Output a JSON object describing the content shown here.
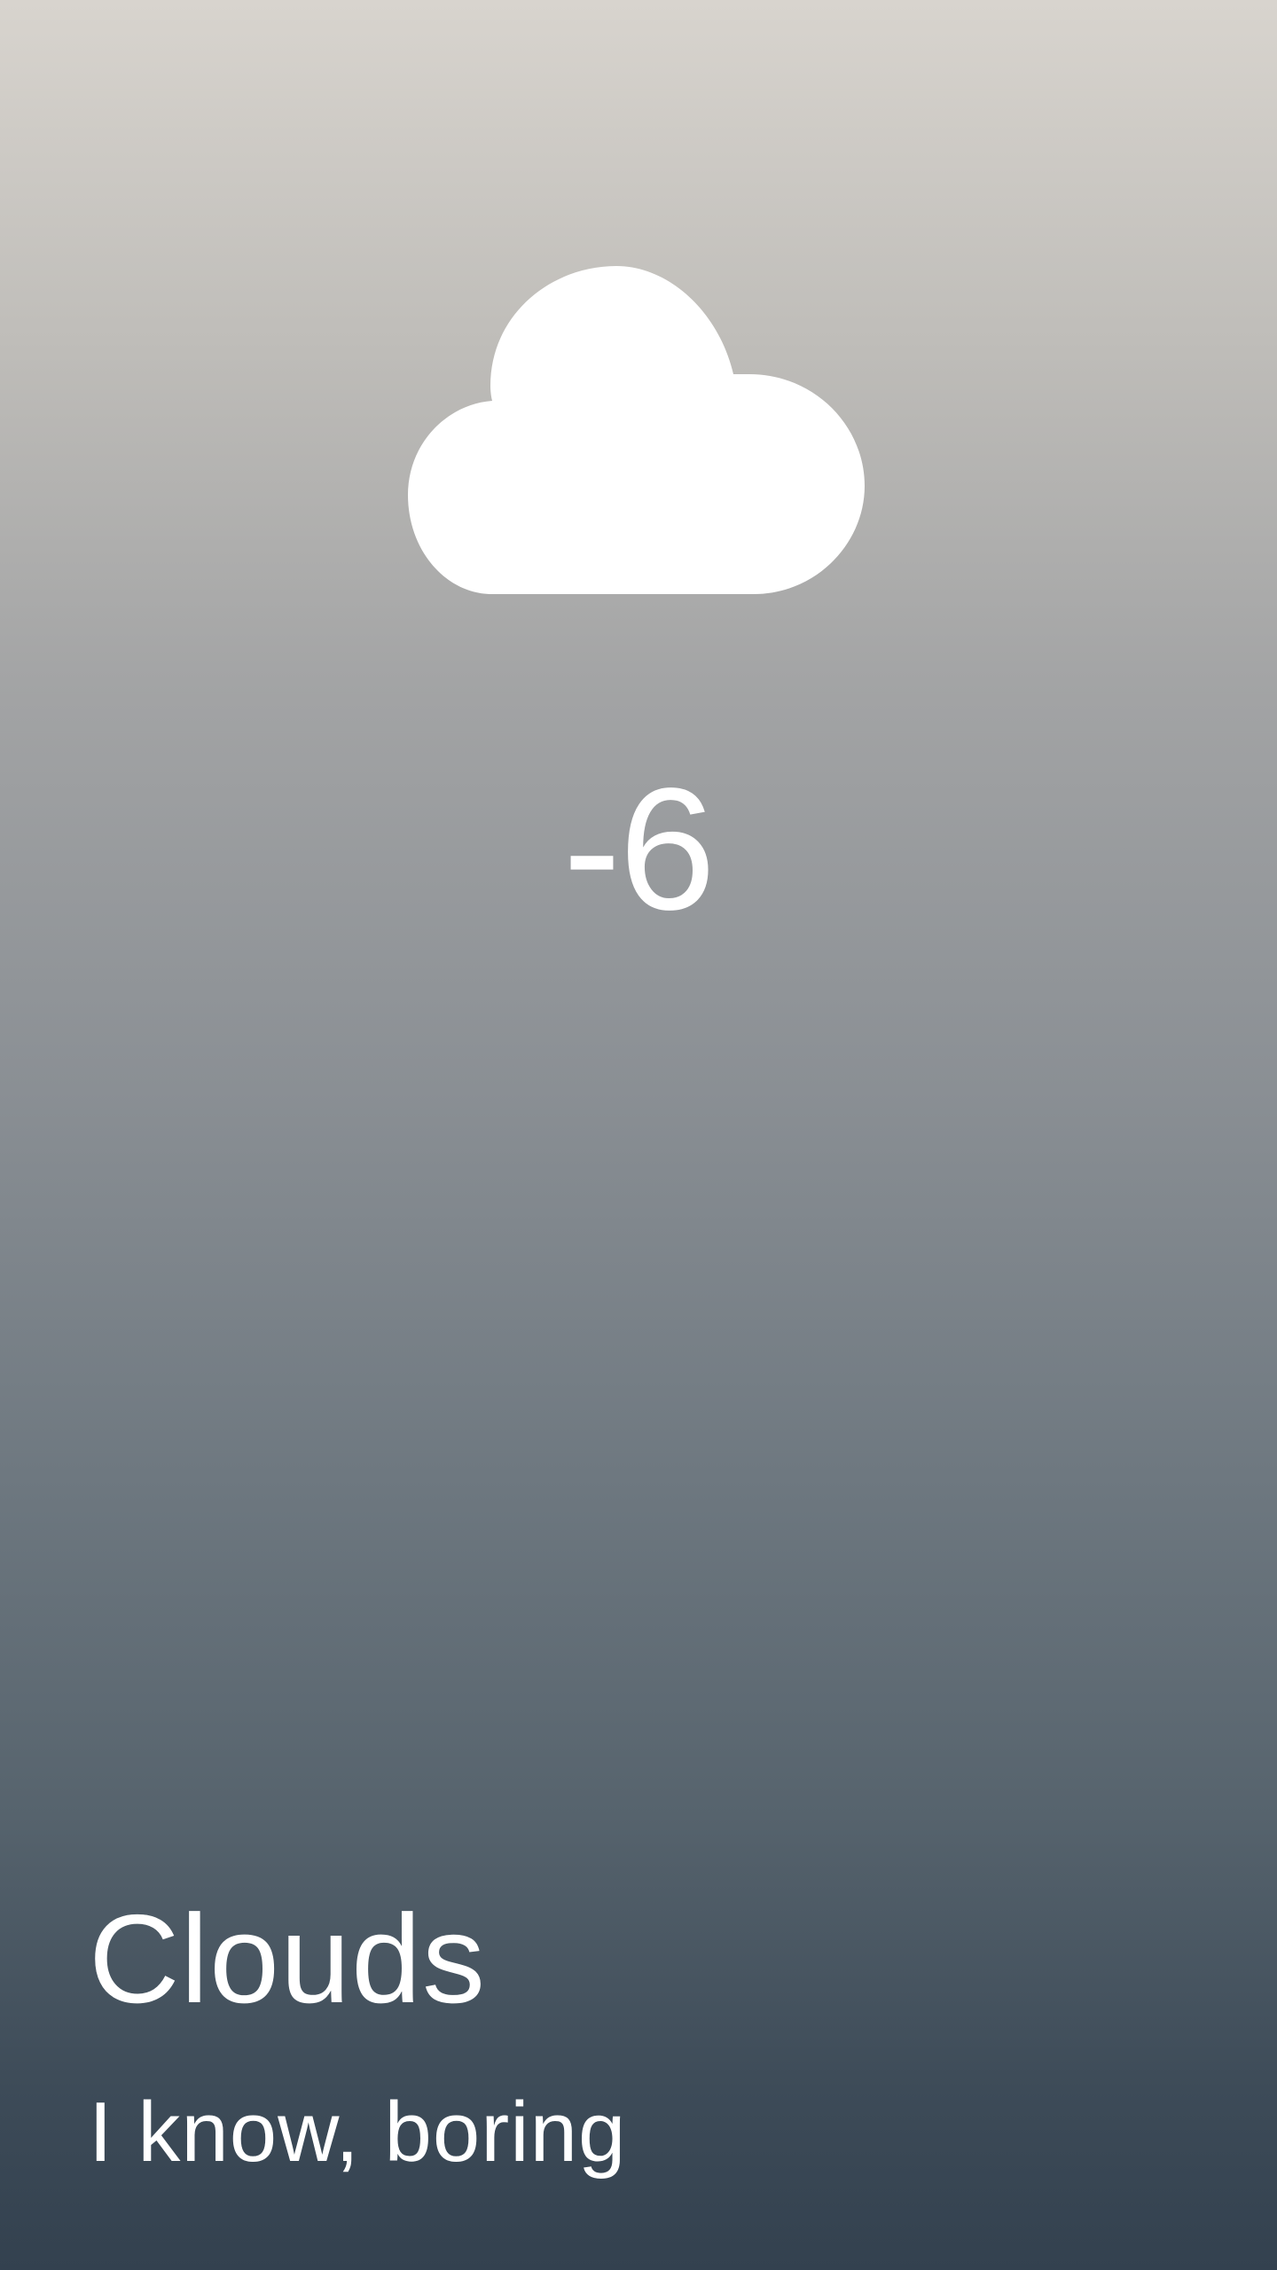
{
  "weather": {
    "icon": "cloud-icon",
    "temperature": "-6",
    "condition": "Clouds",
    "description": "I know, boring"
  },
  "colors": {
    "background_top": "#d8d4ce",
    "background_bottom": "#33414f",
    "text": "#ffffff"
  }
}
